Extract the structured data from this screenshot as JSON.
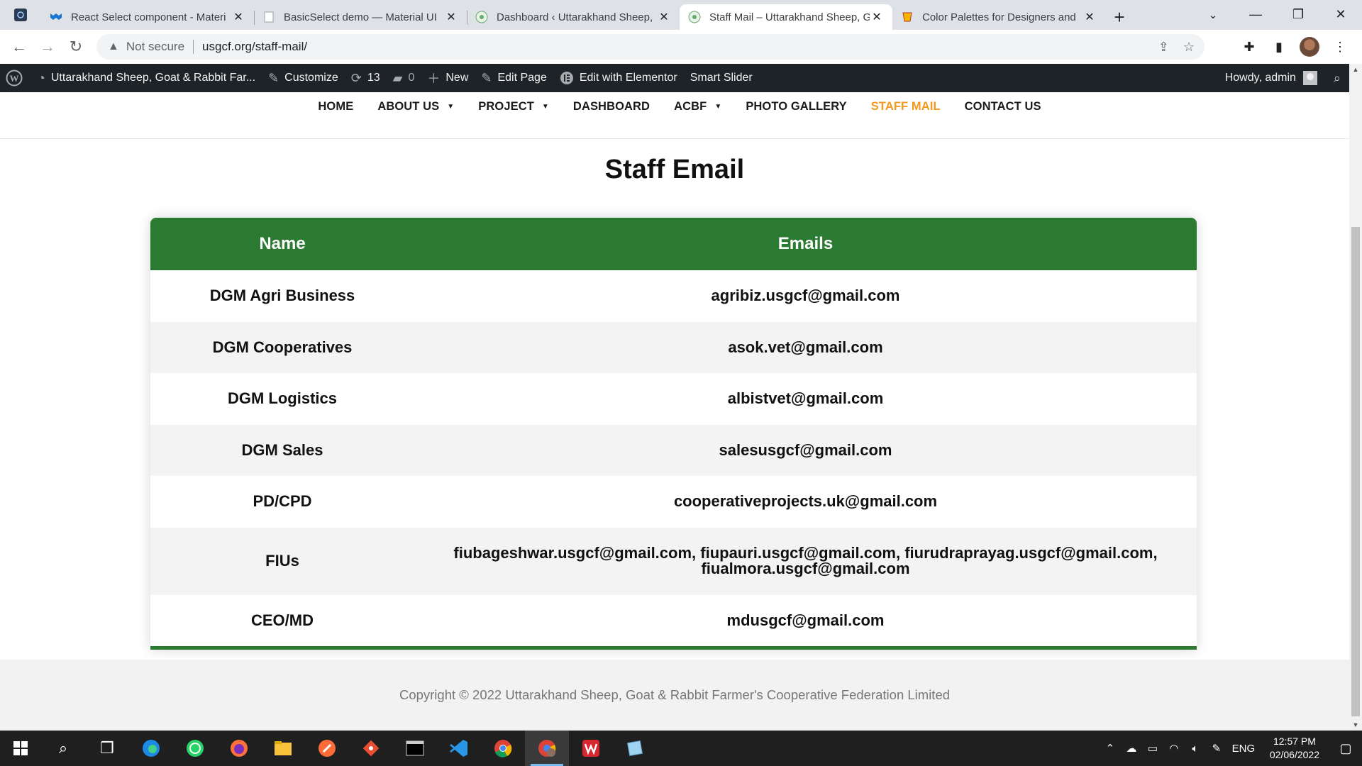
{
  "browser": {
    "tabs": [
      {
        "title": "React Select component - Materi",
        "favicon": "mui-icon",
        "active": false
      },
      {
        "title": "BasicSelect demo — Material UI",
        "favicon": "blank-page-icon",
        "active": false
      },
      {
        "title": "Dashboard ‹ Uttarakhand Sheep,",
        "favicon": "site-logo-icon",
        "active": false
      },
      {
        "title": "Staff Mail – Uttarakhand Sheep, G",
        "favicon": "site-logo-icon",
        "active": true
      },
      {
        "title": "Color Palettes for Designers and",
        "favicon": "palette-icon",
        "active": false
      }
    ],
    "security_label": "Not secure",
    "url": "usgcf.org/staff-mail/"
  },
  "adminbar": {
    "site_name": "Uttarakhand Sheep, Goat & Rabbit Far...",
    "customize": "Customize",
    "updates_count": "13",
    "comments_count": "0",
    "new_label": "New",
    "edit_page": "Edit Page",
    "edit_elementor": "Edit with Elementor",
    "smart_slider": "Smart Slider",
    "howdy": "Howdy, admin"
  },
  "nav": {
    "items": [
      "HOME",
      "ABOUT US",
      "PROJECT",
      "DASHBOARD",
      "ACBF",
      "PHOTO GALLERY",
      "STAFF MAIL",
      "CONTACT US"
    ],
    "active": "STAFF MAIL"
  },
  "page": {
    "title": "Staff Email",
    "table": {
      "headers": [
        "Name",
        "Emails"
      ],
      "rows": [
        {
          "name": "DGM Agri Business",
          "emails": "agribiz.usgcf@gmail.com"
        },
        {
          "name": "DGM Cooperatives",
          "emails": "asok.vet@gmail.com"
        },
        {
          "name": "DGM Logistics",
          "emails": "albistvet@gmail.com"
        },
        {
          "name": "DGM Sales",
          "emails": "salesusgcf@gmail.com"
        },
        {
          "name": "PD/CPD",
          "emails": "cooperativeprojects.uk@gmail.com"
        },
        {
          "name": "FIUs",
          "emails": "fiubageshwar.usgcf@gmail.com, fiupauri.usgcf@gmail.com, fiurudraprayag.usgcf@gmail.com, fiualmora.usgcf@gmail.com"
        },
        {
          "name": "CEO/MD",
          "emails": "mdusgcf@gmail.com"
        }
      ]
    }
  },
  "footer": {
    "copyright": "Copyright © 2022 Uttarakhand Sheep, Goat & Rabbit Farmer's Cooperative Federation Limited"
  },
  "taskbar": {
    "lang": "ENG",
    "time": "12:57 PM",
    "date": "02/06/2022"
  },
  "colors": {
    "table_header": "#2a7a31",
    "nav_active": "#f39a1e",
    "adminbar": "#1d2327"
  }
}
